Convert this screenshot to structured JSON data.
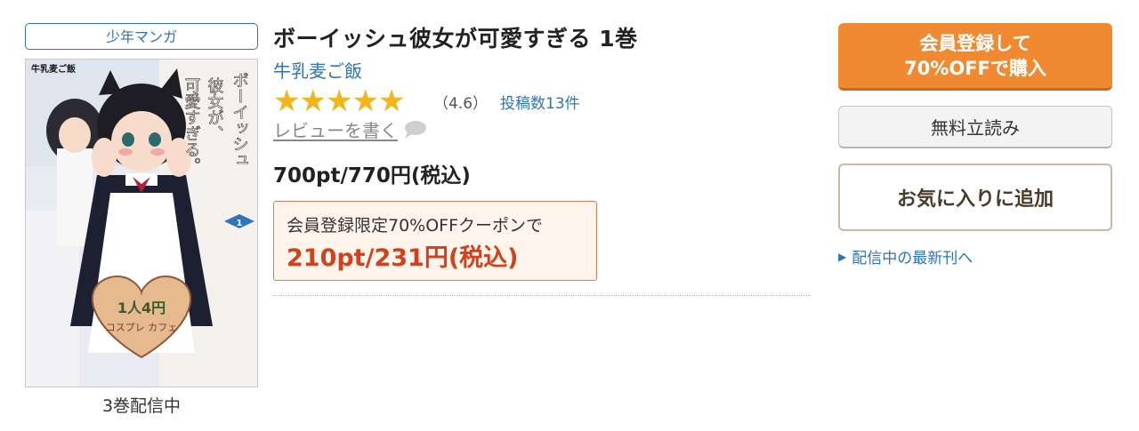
{
  "genre_tag": "少年マンガ",
  "cover": {
    "overlay_author": "牛乳麦ご飯",
    "vertical_title": "ボーイッシュ彼女が、可愛すぎる",
    "volume_mark": "1",
    "badge_text": "1人4円 コスプレ カフェ"
  },
  "volumes_note": "3巻配信中",
  "title": "ボーイッシュ彼女が可愛すぎる 1巻",
  "author": "牛乳麦ご飯",
  "rating": {
    "stars": "★★★★★",
    "score": 4.6,
    "max": 5,
    "value_text": "（4.6）",
    "review_count": "投稿数13件"
  },
  "write_review": "レビューを書く",
  "price": "700pt/770円(税込)",
  "coupon": {
    "label": "会員登録限定70%OFFクーポンで",
    "price": "210pt/231円(税込)"
  },
  "buttons": {
    "register_line1": "会員登録して",
    "register_line2": "70%OFFで購入",
    "free_read": "無料立読み",
    "favorite": "お気に入りに追加"
  },
  "latest_link": "配信中の最新刊へ",
  "colors": {
    "link_blue": "#2f74b5",
    "accent_orange": "#f08a32",
    "star_gold": "#f2b51d",
    "coupon_red": "#d0421b"
  },
  "icons": {
    "review": "speech-bubble-icon",
    "latest": "triangle-right-icon"
  }
}
